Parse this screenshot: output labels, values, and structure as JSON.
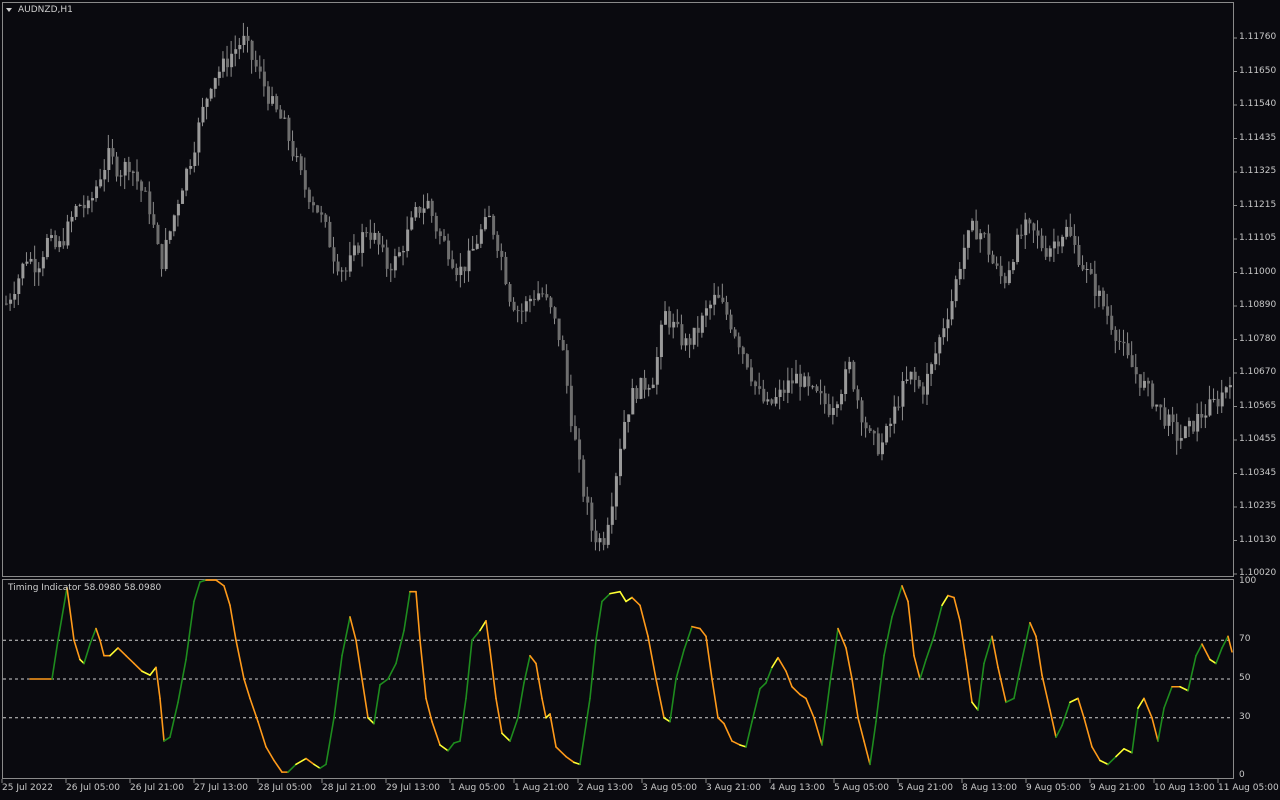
{
  "window": {
    "menu_arrow_icon": "triangle-down-icon",
    "title": "AUDNZD,H1"
  },
  "price_axis": {
    "labels": [
      "1.11760",
      "1.11650",
      "1.11540",
      "1.11435",
      "1.11325",
      "1.11215",
      "1.11105",
      "1.11000",
      "1.10890",
      "1.10780",
      "1.10670",
      "1.10565",
      "1.10455",
      "1.10345",
      "1.10235",
      "1.10130",
      "1.10020"
    ]
  },
  "indicator": {
    "title": "Timing Indicator 58.0980 58.0980",
    "axis_labels": [
      "100",
      "70",
      "50",
      "30",
      "0"
    ],
    "levels": [
      70,
      50,
      30
    ],
    "colors": {
      "rising": "#1e8c1e",
      "falling": "#ff9a1a",
      "turn": "#ffff33"
    }
  },
  "time_axis": {
    "labels": [
      "25 Jul 2022",
      "26 Jul 05:00",
      "26 Jul 21:00",
      "27 Jul 13:00",
      "28 Jul 05:00",
      "28 Jul 21:00",
      "29 Jul 13:00",
      "1 Aug 05:00",
      "1 Aug 21:00",
      "2 Aug 13:00",
      "3 Aug 05:00",
      "3 Aug 21:00",
      "4 Aug 13:00",
      "5 Aug 05:00",
      "5 Aug 21:00",
      "8 Aug 13:00",
      "9 Aug 05:00",
      "9 Aug 21:00",
      "10 Aug 13:00",
      "11 Aug 05:00"
    ]
  },
  "chart_data": {
    "type": "candlestick",
    "symbol": "AUDNZD",
    "timeframe": "H1",
    "price_range": [
      1.1002,
      1.1182
    ],
    "close_path": [
      1.1088,
      1.1095,
      1.1103,
      1.11,
      1.1108,
      1.1105,
      1.1112,
      1.112,
      1.1118,
      1.1128,
      1.1135,
      1.113,
      1.1133,
      1.1125,
      1.1118,
      1.11,
      1.1112,
      1.1125,
      1.1135,
      1.1148,
      1.116,
      1.1163,
      1.1168,
      1.1172,
      1.1165,
      1.1158,
      1.115,
      1.1145,
      1.1135,
      1.1125,
      1.112,
      1.1112,
      1.1102,
      1.1098,
      1.1105,
      1.1112,
      1.1108,
      1.11,
      1.1102,
      1.111,
      1.1118,
      1.112,
      1.111,
      1.1105,
      1.1098,
      1.1102,
      1.111,
      1.1115,
      1.1105,
      1.109,
      1.1085,
      1.109,
      1.1092,
      1.1085,
      1.1075,
      1.105,
      1.103,
      1.1015,
      1.1012,
      1.1028,
      1.105,
      1.106,
      1.1062,
      1.1065,
      1.1085,
      1.108,
      1.1075,
      1.1078,
      1.1085,
      1.109,
      1.1085,
      1.1078,
      1.107,
      1.106,
      1.1055,
      1.1058,
      1.1062,
      1.1065,
      1.106,
      1.1058,
      1.1055,
      1.106,
      1.1068,
      1.1055,
      1.1045,
      1.1042,
      1.105,
      1.106,
      1.1065,
      1.106,
      1.1068,
      1.108,
      1.109,
      1.1105,
      1.1112,
      1.111,
      1.11,
      1.1095,
      1.1105,
      1.1112,
      1.111,
      1.1105,
      1.1108,
      1.1112,
      1.1105,
      1.1098,
      1.1092,
      1.1085,
      1.1078,
      1.107,
      1.1065,
      1.106,
      1.1055,
      1.105,
      1.1045,
      1.1048,
      1.1052,
      1.1055,
      1.1058,
      1.1065
    ]
  }
}
